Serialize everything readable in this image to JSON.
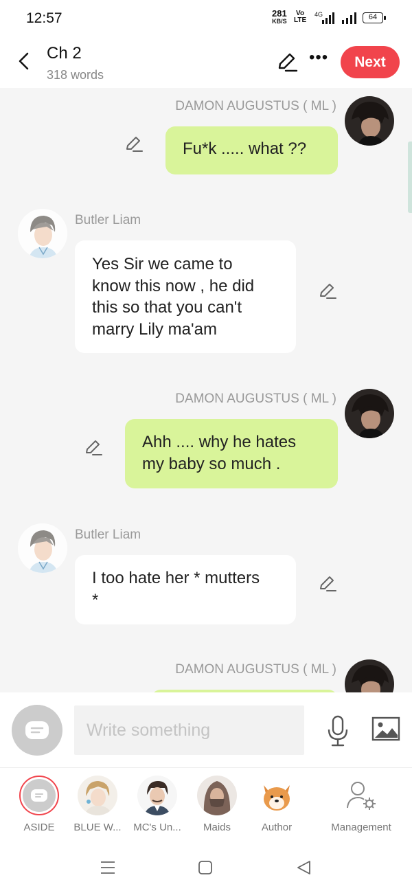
{
  "status": {
    "time": "12:57",
    "speed_value": "281",
    "speed_unit": "KB/S",
    "volte_top": "Vo",
    "volte_bottom": "LTE",
    "network": "4G",
    "battery": "64"
  },
  "header": {
    "title": "Ch 2",
    "subtitle": "318 words",
    "next_label": "Next"
  },
  "messages": [
    {
      "side": "right",
      "name": "DAMON AUGUSTUS ( ML )",
      "text": "Fu*k  ..... what ??"
    },
    {
      "side": "left",
      "name": "Butler Liam",
      "lines": [
        "Yes Sir we came to",
        "know this now , he did",
        "this so that you can't",
        "marry Lily ma'am"
      ]
    },
    {
      "side": "right",
      "name": "DAMON AUGUSTUS ( ML )",
      "lines": [
        "Ahh .... why he hates",
        "my baby so much ."
      ]
    },
    {
      "side": "left",
      "name": "Butler Liam",
      "lines": [
        "I too hate her * mutters",
        "*"
      ]
    },
    {
      "side": "right",
      "name": "DAMON AUGUSTUS ( ML )"
    }
  ],
  "input": {
    "placeholder": "Write something"
  },
  "characters": [
    {
      "label": "ASIDE"
    },
    {
      "label": "BLUE W..."
    },
    {
      "label": "MC's Un..."
    },
    {
      "label": "Maids"
    },
    {
      "label": "Author"
    },
    {
      "label": "Management"
    }
  ],
  "colors": {
    "accent": "#f1444c",
    "bubble_green": "#d9f49a",
    "chat_bg": "#f5f5f5"
  }
}
